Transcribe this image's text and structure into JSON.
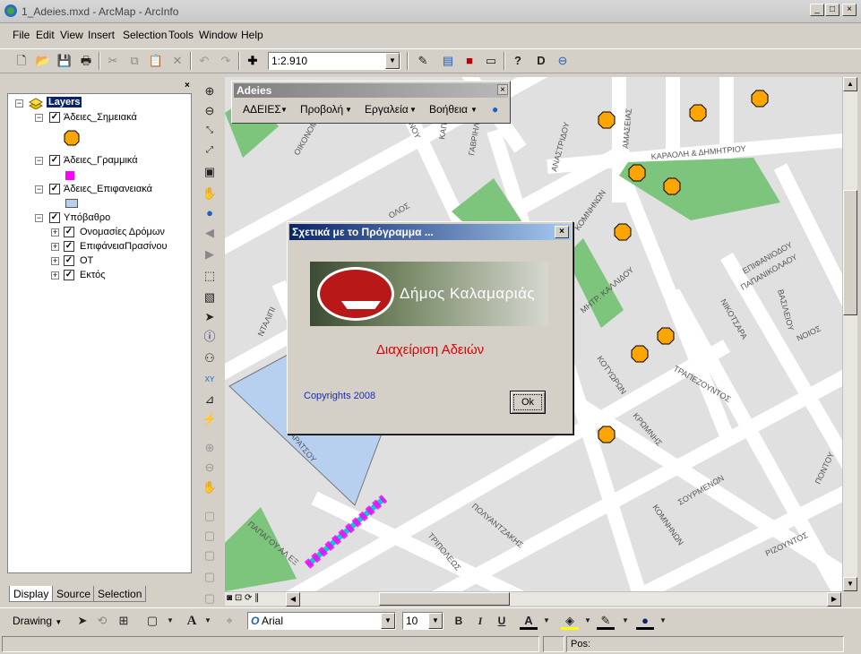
{
  "window": {
    "title": "1_Adeies.mxd - ArcMap - ArcInfo",
    "min": "_",
    "max": "□",
    "close": "×"
  },
  "menu": [
    "File",
    "Edit",
    "View",
    "Insert",
    "Selection",
    "Tools",
    "Window",
    "Help"
  ],
  "standard_toolbar": {
    "scale": "1:2.910"
  },
  "toc": {
    "root": "Layers",
    "layers": [
      {
        "label": "Άδειες_Σημειακά",
        "symbol": "circle-orange"
      },
      {
        "label": "Άδειες_Γραμμικά",
        "symbol": "rect-magenta"
      },
      {
        "label": "Άδειες_Επιφανειακά",
        "symbol": "rect-lightblue"
      },
      {
        "label": "Υπόβαθρο"
      }
    ],
    "sublayers": [
      "Ονομασίες Δρόμων",
      "ΕπιφάνειαΠρασίνου",
      "ΟΤ",
      "Εκτός"
    ],
    "tabs": [
      "Display",
      "Source",
      "Selection"
    ]
  },
  "adeies_toolbar": {
    "title": "Adeies",
    "menus": [
      "ΑΔΕΙΕΣ",
      "Προβολή",
      "Εργαλεία",
      "Βοήθεια"
    ]
  },
  "dialog": {
    "title": "Σχετικά με το Πρόγραμμα ...",
    "municipality": "Δήμος Καλαμαριάς",
    "app_name": "Διαχείριση Αδειών",
    "copyright": "Copyrights 2008",
    "ok": "Ok"
  },
  "map": {
    "street_labels": [
      {
        "text": "ΟΙΚΟΝΟΜΙΔΟΥ"
      },
      {
        "text": "ΝΟΥ"
      },
      {
        "text": "ΚΑΠΕΤ"
      },
      {
        "text": "ΓΑΒΡΙΗΛ"
      },
      {
        "text": "ΑΝΑΣΤΡΙΔΟΥ"
      },
      {
        "text": "ΑΜΑΣΕΙΑΣ"
      },
      {
        "text": "ΚΑΡΑΟΛΗ & ΔΗΜΗΤΡΙΟΥ"
      },
      {
        "text": "ΚΟΜΝΗΝΩΝ"
      },
      {
        "text": "ΟΛΟΣ"
      },
      {
        "text": "ΝΤΑΛΙΠΙ"
      },
      {
        "text": "ΜΗΤΡ. ΚΑΛΛΙΔΟΥ"
      },
      {
        "text": "ΕΠΙΦΑΝΙΟΔΟΥ"
      },
      {
        "text": "ΠΑΠΑΝΙΚΟΛΑΟΥ"
      },
      {
        "text": "ΝΙΚΟΤΣΑΡΑ"
      },
      {
        "text": "ΒΑΣΙΛΕΙΟΥ"
      },
      {
        "text": "ΝΟΙΟΣ"
      },
      {
        "text": "ΤΡΑΠΕΖΟΥΝΤΟΣ"
      },
      {
        "text": "ΚΟΤΥΩΡΩΝ"
      },
      {
        "text": "ΚΡΩΜΝΗΣ"
      },
      {
        "text": "ΣΟΥΡΜΕΝΩΝ"
      },
      {
        "text": "ΚΟΜΝΗΝΩΝ"
      },
      {
        "text": "ΡΙΖΟΥΝΤΟΣ"
      },
      {
        "text": "ΠΟΝΤΟΥ"
      },
      {
        "text": "ΠΟΛΥΑΝΤΖΑΚΗΣ"
      },
      {
        "text": "ΤΡΙΠΟΛΕΩΣ"
      },
      {
        "text": "ΠΑΠΑΓΟΥ ΑΛ ΕΞ"
      },
      {
        "text": "ΚΑΡΑΤΣΟΥ"
      }
    ]
  },
  "drawing_toolbar": {
    "label": "Drawing",
    "font": "Arial",
    "size": "10"
  },
  "status": {
    "pos": "Pos:"
  },
  "colors": {
    "point": "#ffa500",
    "line": "#ff00ff",
    "polygon": "#b8d0f0",
    "green": "#7dc47d",
    "road": "#ffffff",
    "block": "#d9d9d9"
  }
}
